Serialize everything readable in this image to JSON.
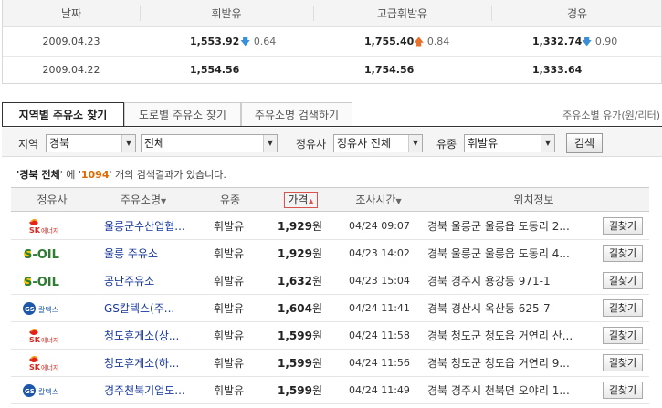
{
  "price_summary": {
    "headers": [
      "날짜",
      "휘발유",
      "고급휘발유",
      "경유"
    ],
    "rows": [
      {
        "date": "2009.04.23",
        "gasoline": "1,553.92",
        "gasoline_change": "0.64",
        "gasoline_dir": "down",
        "premium": "1,755.40",
        "premium_change": "0.84",
        "premium_dir": "up",
        "diesel": "1,332.74",
        "diesel_change": "0.90",
        "diesel_dir": "down"
      },
      {
        "date": "2009.04.22",
        "gasoline": "1,554.56",
        "premium": "1,754.56",
        "diesel": "1,333.64"
      }
    ]
  },
  "tabs": [
    {
      "label": "지역별 주유소 찾기",
      "active": true
    },
    {
      "label": "도로별 주유소 찾기",
      "active": false
    },
    {
      "label": "주유소명 검색하기",
      "active": false
    }
  ],
  "unit_note": "주유소별 유가(원/리터)",
  "filter": {
    "region_label": "지역",
    "province": "경북",
    "district": "전체",
    "brand_label": "정유사",
    "brand": "정유사 전체",
    "fuel_label": "유종",
    "fuel": "휘발유",
    "search_button": "검색"
  },
  "result_text": {
    "quote_open": "'",
    "query": "경북 전체",
    "quote_close": "' 에 '",
    "count": "1094",
    "suffix": "' 개의 검색결과가 있습니다."
  },
  "table": {
    "headers": {
      "brand": "정유사",
      "name": "주유소명",
      "type": "유종",
      "price": "가격",
      "time": "조사시간",
      "location": "위치정보"
    },
    "rows": [
      {
        "brand": "SK에너지",
        "brand_logo": "sk",
        "name": "울릉군수산업협...",
        "type": "휘발유",
        "price": "1,929",
        "won": "원",
        "time": "04/24 09:07",
        "address": "경북 울릉군 울릉읍 도동리 2...",
        "action": "길찾기"
      },
      {
        "brand": "S-OIL",
        "brand_logo": "soil",
        "name": "울릉 주유소",
        "type": "휘발유",
        "price": "1,929",
        "won": "원",
        "time": "04/23 14:02",
        "address": "경북 울릉군 울릉읍 도동리 4...",
        "action": "길찾기"
      },
      {
        "brand": "S-OIL",
        "brand_logo": "soil",
        "name": "공단주유소",
        "type": "휘발유",
        "price": "1,632",
        "won": "원",
        "time": "04/23 15:04",
        "address": "경북 경주시 용강동 971-1",
        "action": "길찾기"
      },
      {
        "brand": "GS칼텍스",
        "brand_logo": "gs",
        "name": "GS칼텍스(주...",
        "type": "휘발유",
        "price": "1,604",
        "won": "원",
        "time": "04/24 11:41",
        "address": "경북 경산시 옥산동 625-7",
        "action": "길찾기"
      },
      {
        "brand": "SK에너지",
        "brand_logo": "sk",
        "name": "청도휴게소(상...",
        "type": "휘발유",
        "price": "1,599",
        "won": "원",
        "time": "04/24 11:58",
        "address": "경북 청도군 청도읍 거연리 산...",
        "action": "길찾기"
      },
      {
        "brand": "SK에너지",
        "brand_logo": "sk",
        "name": "청도휴게소(하...",
        "type": "휘발유",
        "price": "1,599",
        "won": "원",
        "time": "04/24 11:56",
        "address": "경북 청도군 청도읍 거연리 9...",
        "action": "길찾기"
      },
      {
        "brand": "GS칼텍스",
        "brand_logo": "gs",
        "name": "경주천북기업도...",
        "type": "휘발유",
        "price": "1,599",
        "won": "원",
        "time": "04/24 11:49",
        "address": "경북 경주시 천북면 오야리 1...",
        "action": "길찾기"
      }
    ]
  },
  "colors": {
    "link_blue": "#1a3a9c",
    "count_orange": "#e06a00",
    "down_arrow": "#3b8fd6",
    "up_arrow": "#e8702a",
    "sk_red": "#e2231a",
    "soil_green": "#2e7d32",
    "soil_yellow": "#f5c400",
    "gs_blue": "#1d57a8"
  }
}
